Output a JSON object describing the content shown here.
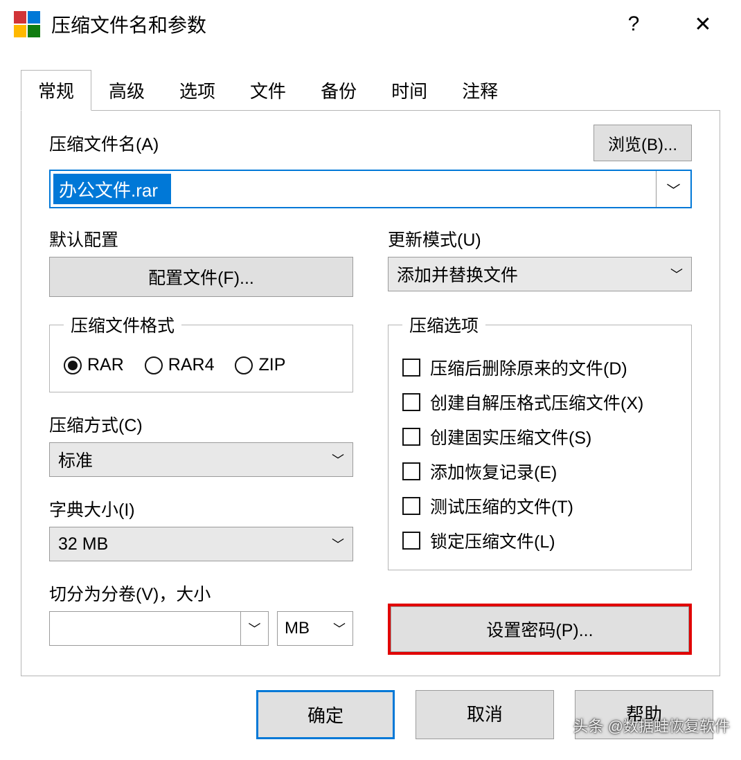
{
  "window": {
    "title": "压缩文件名和参数",
    "help": "?",
    "close": "✕"
  },
  "tabs": [
    "常规",
    "高级",
    "选项",
    "文件",
    "备份",
    "时间",
    "注释"
  ],
  "archive": {
    "label": "压缩文件名(A)",
    "browse": "浏览(B)...",
    "filename": "办公文件.rar"
  },
  "profile": {
    "label": "默认配置",
    "button": "配置文件(F)..."
  },
  "update": {
    "label": "更新模式(U)",
    "value": "添加并替换文件"
  },
  "format": {
    "legend": "压缩文件格式",
    "options": [
      "RAR",
      "RAR4",
      "ZIP"
    ],
    "selected": "RAR"
  },
  "method": {
    "label": "压缩方式(C)",
    "value": "标准"
  },
  "dict": {
    "label": "字典大小(I)",
    "value": "32 MB"
  },
  "split": {
    "label": "切分为分卷(V)，大小",
    "value": "",
    "unit": "MB"
  },
  "options": {
    "legend": "压缩选项",
    "items": [
      "压缩后删除原来的文件(D)",
      "创建自解压格式压缩文件(X)",
      "创建固实压缩文件(S)",
      "添加恢复记录(E)",
      "测试压缩的文件(T)",
      "锁定压缩文件(L)"
    ]
  },
  "password": {
    "button": "设置密码(P)..."
  },
  "buttons": {
    "ok": "确定",
    "cancel": "取消",
    "help": "帮助"
  },
  "watermark": "头条 @数据蛙恢复软件"
}
